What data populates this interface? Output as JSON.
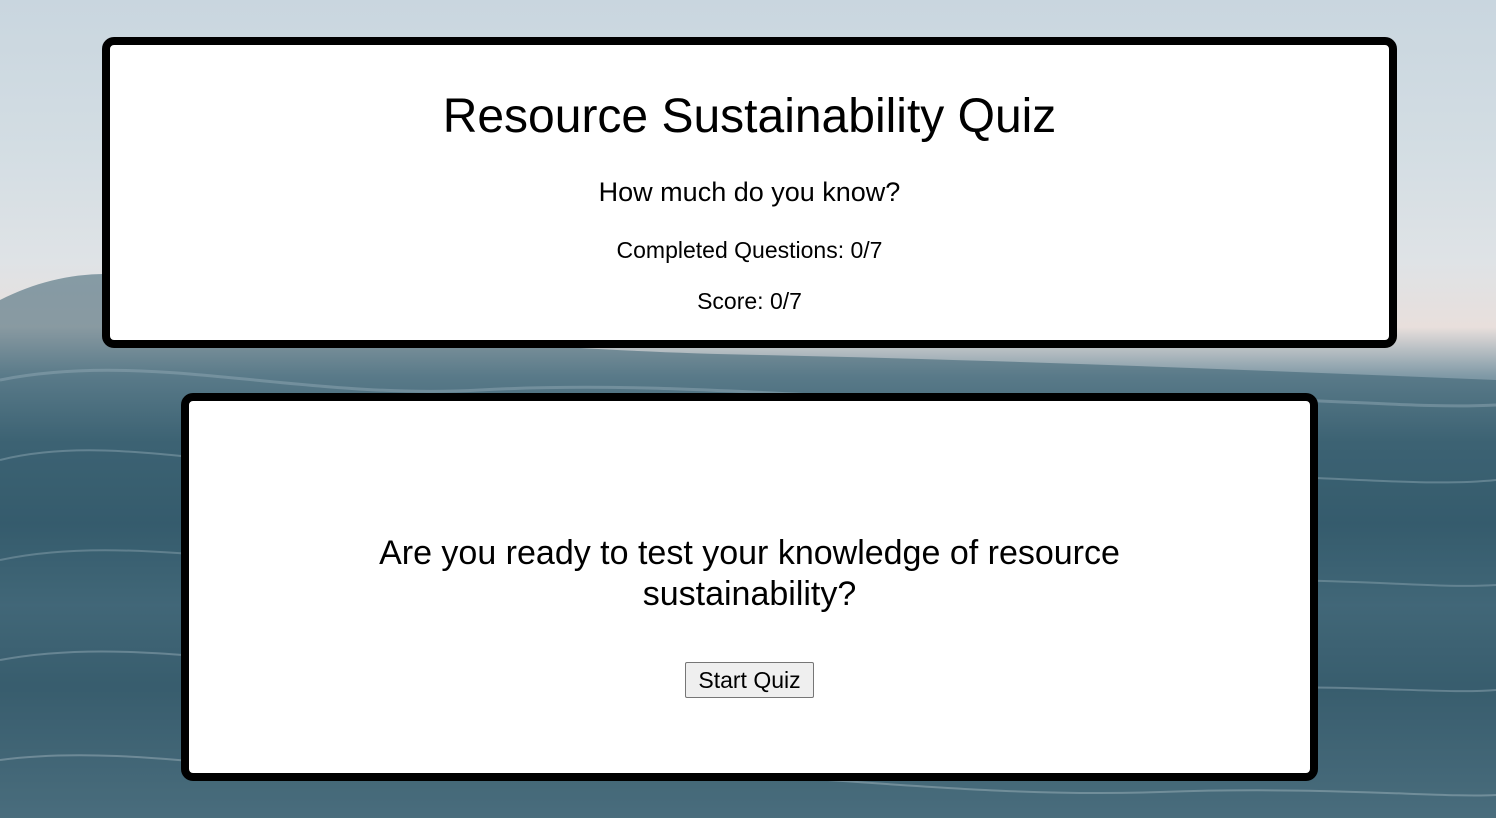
{
  "header": {
    "title": "Resource Sustainability Quiz",
    "subtitle": "How much do you know?",
    "completed_questions": "Completed Questions: 0/7",
    "score": "Score: 0/7"
  },
  "main": {
    "prompt": "Are you ready to test your knowledge of resource sustainability?",
    "start_button_label": "Start Quiz"
  },
  "colors": {
    "card_background": "#ffffff",
    "card_border": "#000000",
    "button_background": "#efefef"
  },
  "background": {
    "description_icon": "ocean-waves-background"
  }
}
